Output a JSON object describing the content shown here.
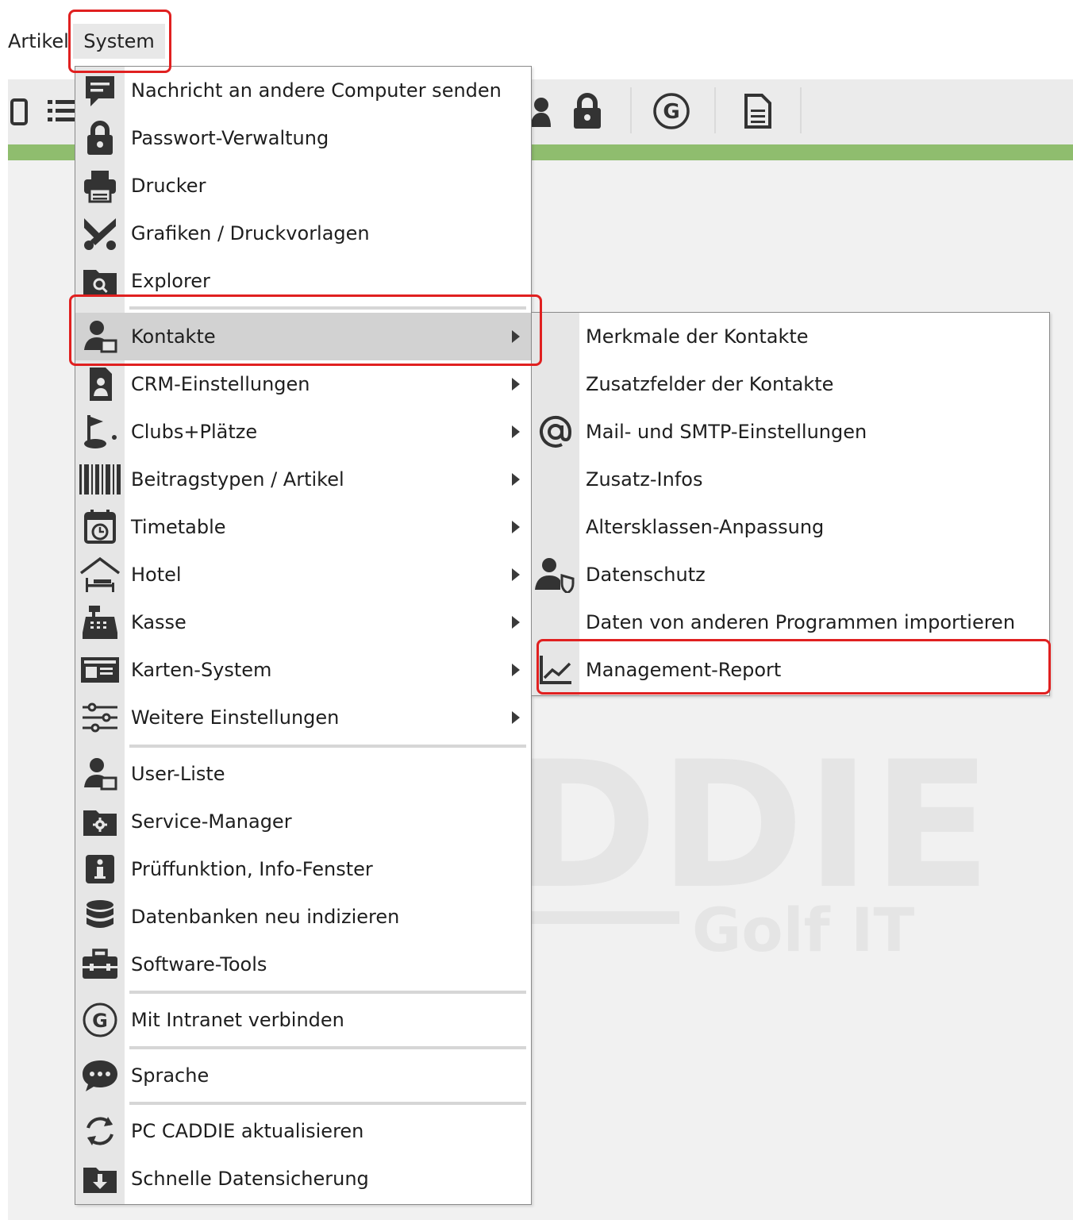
{
  "menubar": {
    "artikel": "Artikel",
    "system": "System"
  },
  "system_menu": {
    "items": [
      {
        "label": "Nachricht an andere Computer senden",
        "icon": "message-icon"
      },
      {
        "label": "Passwort-Verwaltung",
        "icon": "lock-icon"
      },
      {
        "label": "Drucker",
        "icon": "printer-icon"
      },
      {
        "label": "Grafiken / Druckvorlagen",
        "icon": "scissors-icon"
      },
      {
        "label": "Explorer",
        "icon": "folder-search-icon"
      },
      {
        "label": "Kontakte",
        "icon": "contacts-icon",
        "submenu": true
      },
      {
        "label": "CRM-Einstellungen",
        "icon": "crm-icon",
        "submenu": true
      },
      {
        "label": "Clubs+Plätze",
        "icon": "golf-flag-icon",
        "submenu": true
      },
      {
        "label": "Beitragstypen / Artikel",
        "icon": "barcode-icon",
        "submenu": true
      },
      {
        "label": "Timetable",
        "icon": "calendar-clock-icon",
        "submenu": true
      },
      {
        "label": "Hotel",
        "icon": "hotel-icon",
        "submenu": true
      },
      {
        "label": "Kasse",
        "icon": "cash-register-icon",
        "submenu": true
      },
      {
        "label": "Karten-System",
        "icon": "id-card-icon",
        "submenu": true
      },
      {
        "label": "Weitere Einstellungen",
        "icon": "sliders-icon",
        "submenu": true
      },
      {
        "label": "User-Liste",
        "icon": "users-icon"
      },
      {
        "label": "Service-Manager",
        "icon": "folder-gear-icon"
      },
      {
        "label": "Prüffunktion, Info-Fenster",
        "icon": "info-icon"
      },
      {
        "label": "Datenbanken neu indizieren",
        "icon": "database-icon"
      },
      {
        "label": "Software-Tools",
        "icon": "toolbox-icon"
      },
      {
        "label": "Mit Intranet verbinden",
        "icon": "intranet-g-icon"
      },
      {
        "label": "Sprache",
        "icon": "speech-bubble-icon"
      },
      {
        "label": "PC CADDIE aktualisieren",
        "icon": "refresh-icon"
      },
      {
        "label": "Schnelle Datensicherung",
        "icon": "download-folder-icon"
      }
    ]
  },
  "kontakte_submenu": {
    "items": [
      {
        "label": "Merkmale der Kontakte",
        "icon": ""
      },
      {
        "label": "Zusatzfelder der Kontakte",
        "icon": ""
      },
      {
        "label": "Mail- und SMTP-Einstellungen",
        "icon": "at-icon"
      },
      {
        "label": "Zusatz-Infos",
        "icon": ""
      },
      {
        "label": "Altersklassen-Anpassung",
        "icon": ""
      },
      {
        "label": "Datenschutz",
        "icon": "user-shield-icon"
      },
      {
        "label": "Daten von anderen Programmen importieren",
        "icon": ""
      },
      {
        "label": "Management-Report",
        "icon": "line-chart-icon"
      }
    ]
  },
  "watermark": {
    "big": "DDIE",
    "small": "Golf IT"
  },
  "colors": {
    "highlight_box": "#e02020",
    "green_bar": "#8fbd6e",
    "menu_gutter": "#e6e6e6"
  }
}
